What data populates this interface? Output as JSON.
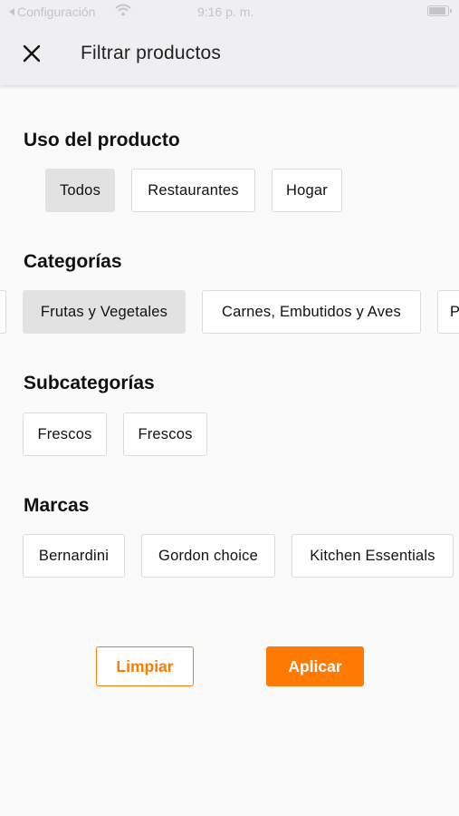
{
  "status_bar": {
    "back_label": "Configuración",
    "time": "9:16 p. m."
  },
  "header": {
    "title": "Filtrar productos",
    "close_icon": "close-icon"
  },
  "sections": {
    "uso": {
      "title": "Uso del producto",
      "options": [
        "Todos",
        "Restaurantes",
        "Hogar"
      ],
      "selected": "Todos"
    },
    "categorias": {
      "title": "Categorías",
      "options": [
        "Frutas y Vegetales",
        "Carnes, Embutidos y Aves",
        "P"
      ],
      "selected": "Frutas y Vegetales"
    },
    "subcategorias": {
      "title": "Subcategorías",
      "options": [
        "Frescos",
        "Frescos"
      ]
    },
    "marcas": {
      "title": "Marcas",
      "options": [
        "Bernardini",
        "Gordon choice",
        "Kitchen Essentials"
      ]
    }
  },
  "actions": {
    "clear_label": "Limpiar",
    "apply_label": "Aplicar"
  },
  "colors": {
    "accent": "#ff7a00",
    "selected_chip": "#e2e2e2",
    "header_bg": "#efeff2"
  }
}
